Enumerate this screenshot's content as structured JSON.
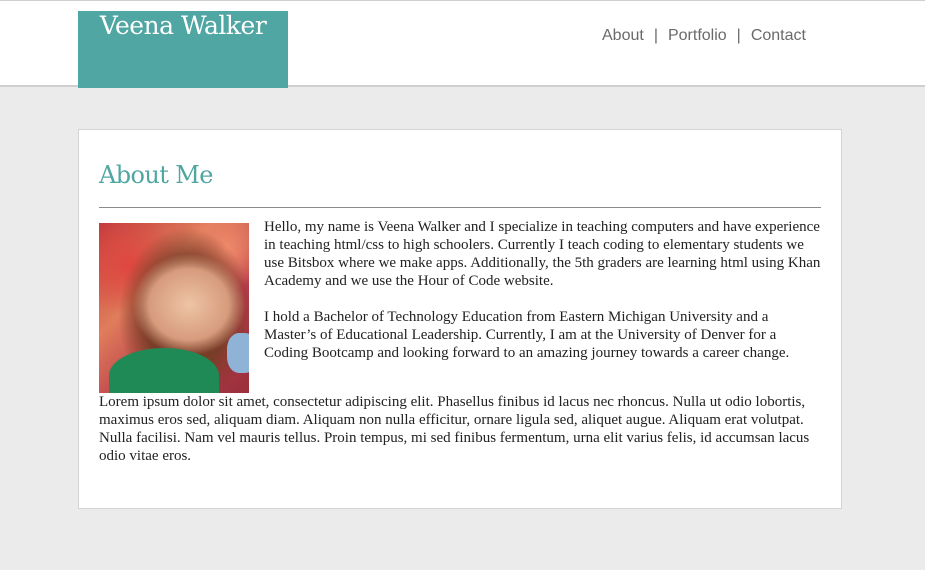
{
  "site": {
    "logo_text": "Veena Walker"
  },
  "nav": {
    "items": [
      {
        "label": "About"
      },
      {
        "label": "Portfolio"
      },
      {
        "label": "Contact"
      }
    ],
    "separator": "|"
  },
  "about": {
    "title": "About Me",
    "paragraph_1": "Hello, my name is Veena Walker and I specialize in teaching computers and have experience in teaching html/css to high schoolers. Currently I teach coding to elementary students we use Bitsbox where we make apps. Additionally, the 5th graders are learning html using Khan Academy and we use the Hour of Code website.",
    "paragraph_2": "I hold a Bachelor of Technology Education from Eastern Michigan University and a Master’s of Educational Leadership. Currently, I am at the University of Denver for a Coding Bootcamp and looking forward to an amazing journey towards a career change.",
    "paragraph_3": "Lorem ipsum dolor sit amet, consectetur adipiscing elit. Phasellus finibus id lacus nec rhoncus. Nulla ut odio lobortis, maximus eros sed, aliquam diam. Aliquam non nulla efficitur, ornare ligula sed, aliquet augue. Aliquam erat volutpat. Nulla facilisi. Nam vel mauris tellus. Proin tempus, mi sed finibus fermentum, urna elit varius felis, id accumsan lacus odio vitae eros."
  },
  "colors": {
    "accent": "#4fa6a2",
    "page_background": "#ebebeb",
    "nav_text": "#6a6a6a"
  }
}
